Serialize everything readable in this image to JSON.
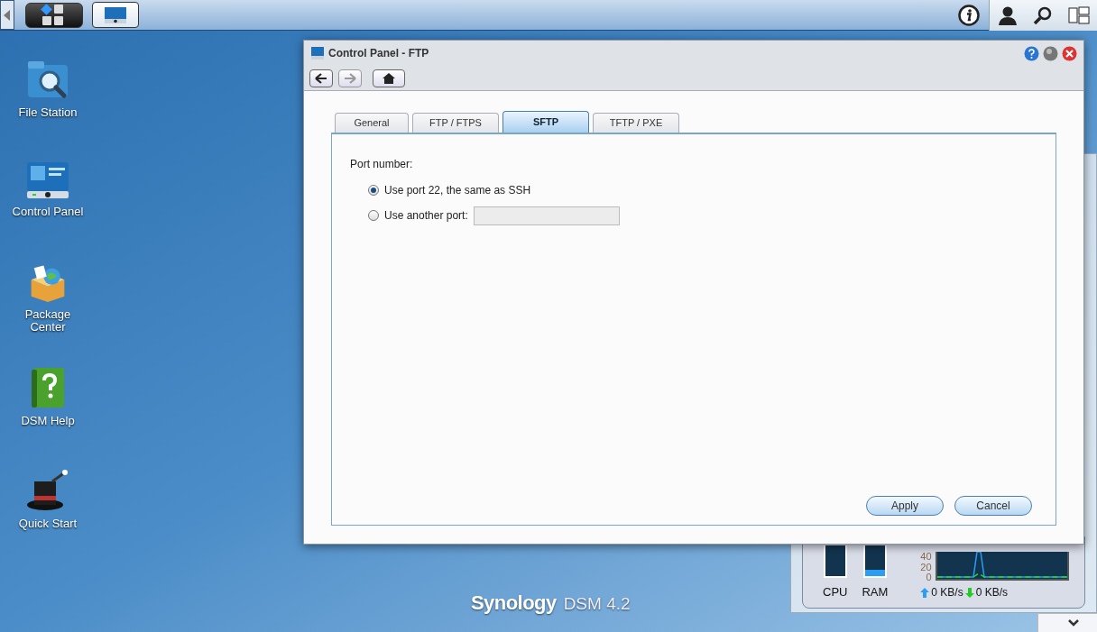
{
  "desktop_icons": [
    {
      "label": "File Station",
      "kind": "folder"
    },
    {
      "label": "Control Panel",
      "kind": "panel"
    },
    {
      "label": "Package Center",
      "kind": "package"
    },
    {
      "label": "DSM Help",
      "kind": "help"
    },
    {
      "label": "Quick Start",
      "kind": "hat"
    }
  ],
  "window": {
    "title": "Control Panel - FTP",
    "tabs": [
      {
        "label": "General",
        "selected": false
      },
      {
        "label": "FTP / FTPS",
        "selected": false
      },
      {
        "label": "SFTP",
        "selected": true
      },
      {
        "label": "TFTP / PXE",
        "selected": false
      }
    ],
    "section_label": "Port number:",
    "port_options": [
      {
        "label": "Use port 22, the same as SSH",
        "selected": true,
        "kind": "plain"
      },
      {
        "label": "Use another port:",
        "selected": false,
        "kind": "input"
      }
    ],
    "buttons": [
      "Apply",
      "Cancel"
    ]
  },
  "resource_monitor": {
    "meters": [
      {
        "label": "CPU"
      },
      {
        "label": "RAM",
        "level": 0.2
      }
    ],
    "upload": "0 KB/s",
    "download": "0 KB/s",
    "axis_labels": [
      "40",
      "20",
      "0"
    ]
  },
  "branding": {
    "name": "Synology",
    "product": "DSM 4.2"
  }
}
